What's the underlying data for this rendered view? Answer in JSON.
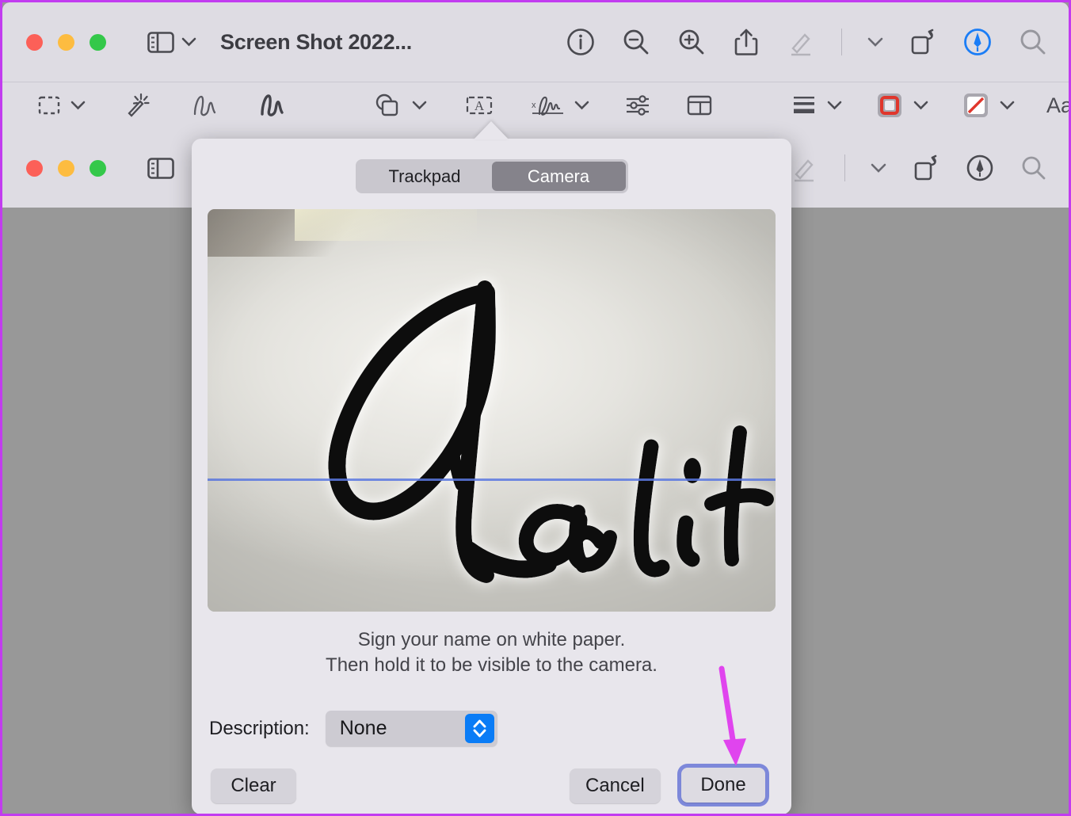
{
  "app": {
    "front_window": {
      "title": "Screen Shot 2022...",
      "traffic_lights": [
        "close",
        "minimize",
        "zoom"
      ],
      "title_tools": [
        {
          "name": "sidebar-view-button",
          "icon": "sidebar-icon",
          "label": ""
        },
        {
          "name": "info-button",
          "icon": "info-circle-icon",
          "label": ""
        },
        {
          "name": "zoom-out-button",
          "icon": "magnifier-minus-icon",
          "label": ""
        },
        {
          "name": "zoom-in-button",
          "icon": "magnifier-plus-icon",
          "label": ""
        },
        {
          "name": "share-button",
          "icon": "share-icon",
          "label": ""
        },
        {
          "name": "markup-button",
          "icon": "pen-highlighter-icon",
          "label": ""
        },
        {
          "name": "markup-options-button",
          "icon": "chevron-down-icon",
          "label": ""
        },
        {
          "name": "rotate-button",
          "icon": "rotate-left-icon",
          "label": ""
        },
        {
          "name": "annotate-button",
          "icon": "markup-pen-circle-icon",
          "label": ""
        },
        {
          "name": "search-button",
          "icon": "search-icon",
          "label": ""
        }
      ],
      "markup_toolbar": [
        {
          "name": "selection-tool",
          "icon": "dashed-rect-icon",
          "has_chevron": true
        },
        {
          "name": "instant-alpha-tool",
          "icon": "magic-wand-icon",
          "has_chevron": false
        },
        {
          "name": "sketch-tool",
          "icon": "sketch-squiggle-icon",
          "has_chevron": false
        },
        {
          "name": "draw-tool",
          "icon": "draw-squiggle-icon",
          "has_chevron": false
        },
        {
          "name": "shapes-tool",
          "icon": "shapes-icon",
          "has_chevron": true
        },
        {
          "name": "text-tool",
          "icon": "text-box-a-icon",
          "has_chevron": false
        },
        {
          "name": "sign-tool",
          "icon": "signature-icon",
          "has_chevron": true
        },
        {
          "name": "adjust-color-tool",
          "icon": "sliders-icon",
          "has_chevron": false
        },
        {
          "name": "adjust-size-tool",
          "icon": "crop-panel-icon",
          "has_chevron": false
        },
        {
          "name": "shape-style-tool",
          "icon": "line-weight-icon",
          "has_chevron": true
        },
        {
          "name": "border-color-tool",
          "icon": "red-square-border-icon",
          "has_chevron": true
        },
        {
          "name": "fill-color-tool",
          "icon": "fill-none-diagonal-icon",
          "has_chevron": true
        },
        {
          "name": "text-style-tool",
          "icon": "aa-icon",
          "label": "Aa",
          "has_chevron": true
        },
        {
          "name": "comment-tool",
          "icon": "speech-bubble-quote-icon",
          "has_chevron": false
        }
      ]
    },
    "back_window": {
      "traffic_lights": [
        "close",
        "minimize",
        "zoom"
      ],
      "title_tools": [
        {
          "name": "sidebar-view-button",
          "icon": "sidebar-icon"
        },
        {
          "name": "markup-button",
          "icon": "pen-highlighter-icon"
        },
        {
          "name": "markup-options-button",
          "icon": "chevron-down-icon"
        },
        {
          "name": "rotate-button",
          "icon": "rotate-left-icon"
        },
        {
          "name": "annotate-button",
          "icon": "markup-pen-circle-icon"
        },
        {
          "name": "search-button",
          "icon": "search-icon"
        }
      ]
    }
  },
  "popover": {
    "segmented": {
      "options": [
        "Trackpad",
        "Camera"
      ],
      "selected": "Camera"
    },
    "camera_preview": {
      "signature_text": "Ranjit",
      "baseline_color": "#5c79e0",
      "paper_color": "#e5e4df",
      "ink_color": "#0d0d0d"
    },
    "instructions": {
      "line1": "Sign your name on white paper.",
      "line2": "Then hold it to be visible to the camera."
    },
    "description": {
      "label": "Description:",
      "value": "None",
      "options": [
        "None"
      ]
    },
    "buttons": {
      "clear": "Clear",
      "cancel": "Cancel",
      "done": "Done"
    }
  },
  "annotation": {
    "arrow_color": "#e044ee",
    "points_to": "done-button"
  },
  "colors": {
    "frame_highlight": "#c23cf0",
    "window_chrome": "#dedce3",
    "popover_bg": "#e8e6ec",
    "document_bg": "#989898",
    "focus_ring": "#7d88da",
    "accent_blue": "#0a7cf6",
    "border_red": "#e0362c"
  }
}
